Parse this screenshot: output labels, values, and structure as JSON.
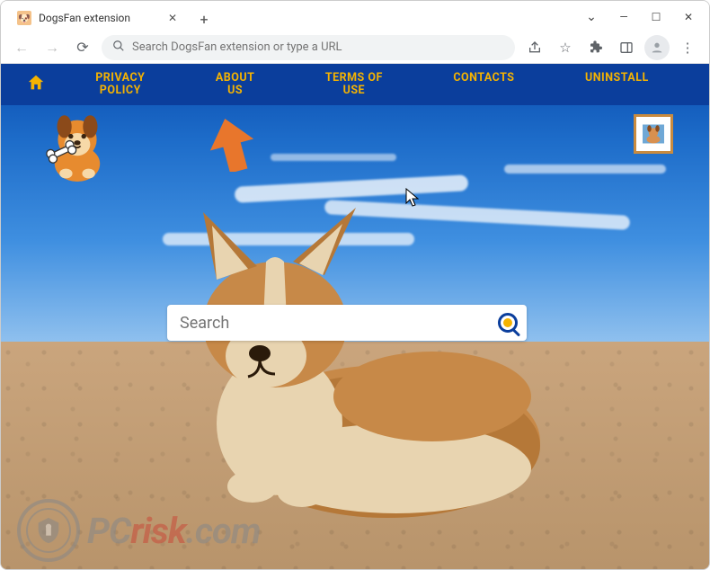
{
  "window": {
    "tab_title": "DogsFan extension",
    "controls": {
      "dropdown": "⌄",
      "minimize": "—",
      "maximize": "☐",
      "close": "✕"
    }
  },
  "toolbar": {
    "omnibox_placeholder": "Search DogsFan extension or type a URL"
  },
  "nav": {
    "items": [
      {
        "label": "PRIVACY\nPOLICY"
      },
      {
        "label": "ABOUT\nUS"
      },
      {
        "label": "TERMS OF\nUSE"
      },
      {
        "label": "CONTACTS"
      },
      {
        "label": "UNINSTALL"
      }
    ]
  },
  "search": {
    "placeholder": "Search"
  },
  "watermark": {
    "text_a": "PC",
    "text_b": "risk",
    "text_c": ".com"
  },
  "colors": {
    "navbg": "#0b3e9c",
    "accent": "#f5b301"
  }
}
